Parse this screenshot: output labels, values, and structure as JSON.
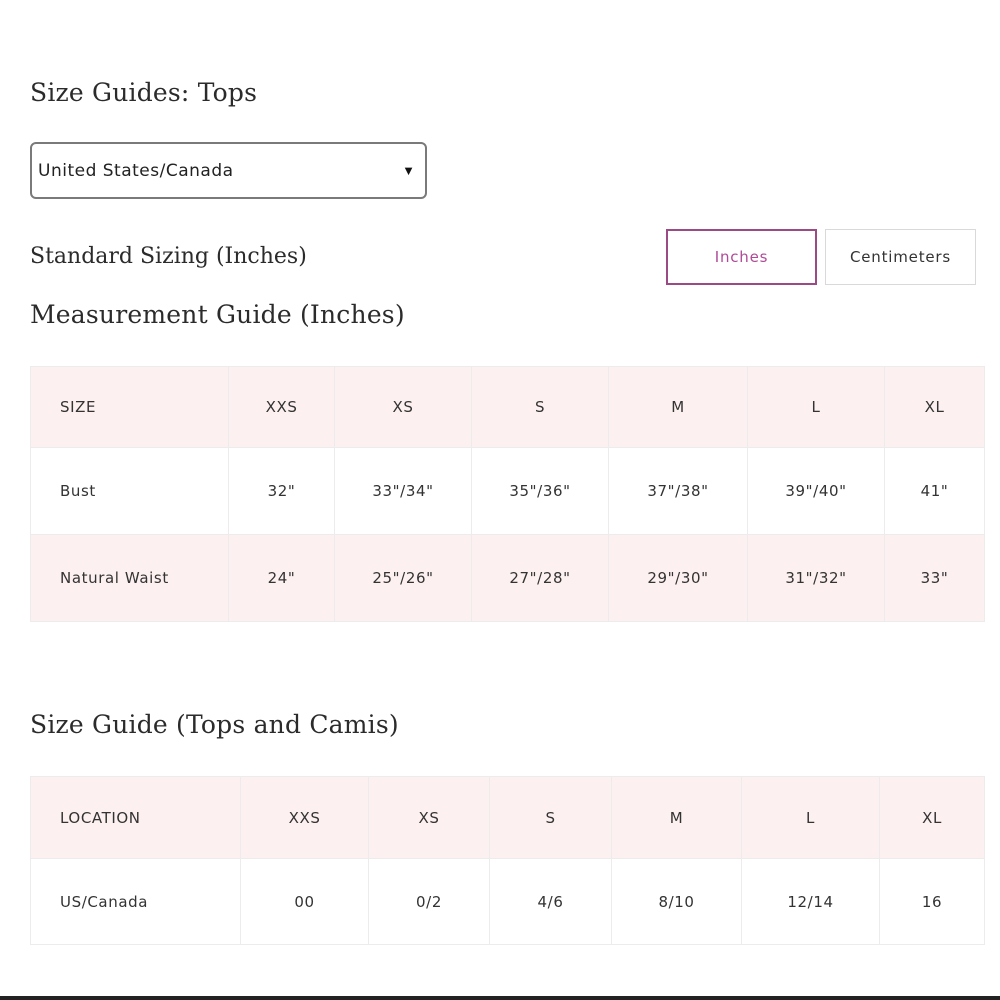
{
  "page": {
    "title": "Size Guides: Tops"
  },
  "region_select": {
    "value": "United States/Canada",
    "caret": "▼"
  },
  "standard_sizing": {
    "label": "Standard Sizing (Inches)"
  },
  "unit_toggle": {
    "options": [
      "Inches",
      "Centimeters"
    ],
    "selected": "Inches",
    "active_color": "#b04a97"
  },
  "measurement_guide": {
    "title": "Measurement Guide (Inches)",
    "header": [
      "SIZE",
      "XXS",
      "XS",
      "S",
      "M",
      "L",
      "XL"
    ],
    "rows": [
      [
        "Bust",
        "32\"",
        "33\"/34\"",
        "35\"/36\"",
        "37\"/38\"",
        "39\"/40\"",
        "41\""
      ],
      [
        "Natural Waist",
        "24\"",
        "25\"/26\"",
        "27\"/28\"",
        "29\"/30\"",
        "31\"/32\"",
        "33\""
      ]
    ]
  },
  "size_guide": {
    "title": "Size Guide (Tops and Camis)",
    "header": [
      "LOCATION",
      "XXS",
      "XS",
      "S",
      "M",
      "L",
      "XL"
    ],
    "rows": [
      [
        "US/Canada",
        "00",
        "0/2",
        "4/6",
        "8/10",
        "12/14",
        "16"
      ]
    ]
  },
  "colors": {
    "header_row_bg": "#fdf0f0",
    "border": "#ececec"
  }
}
